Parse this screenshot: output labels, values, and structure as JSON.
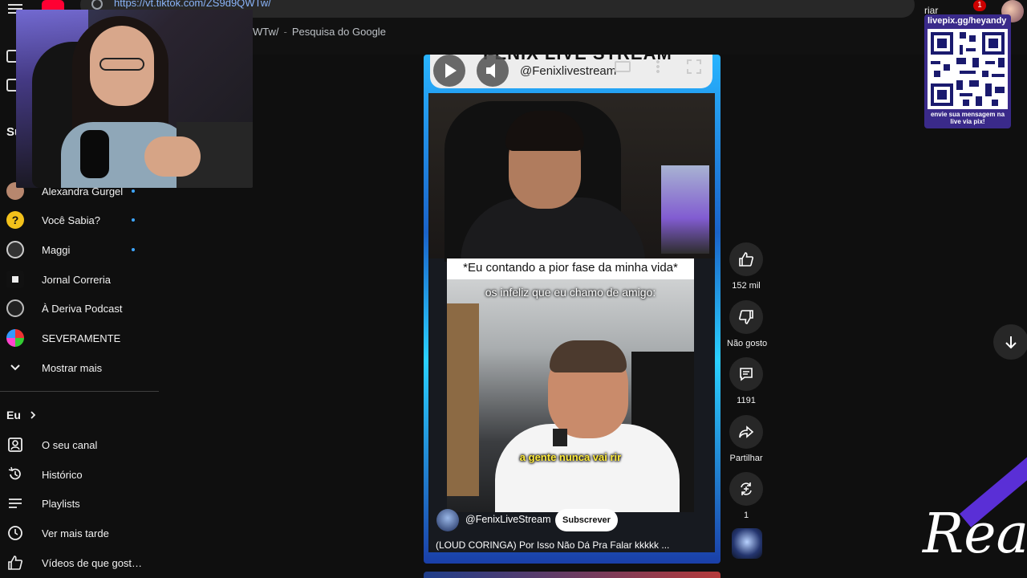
{
  "browser": {
    "url": "https://vt.tiktok.com/ZS9d9QWTw/",
    "suggestion_fragment": "WTw/",
    "suggestion_sep": "-",
    "suggestion_engine": "Pesquisa do Google"
  },
  "header": {
    "create_label": "riar",
    "notifications_count": "1"
  },
  "sidebar": {
    "subscriptions_partial": "Su",
    "subscriptions": [
      {
        "label": "Alexandra Gurgel",
        "icon": "channel-avatar",
        "new": true
      },
      {
        "label": "Você Sabia?",
        "icon": "question-icon",
        "new": true
      },
      {
        "label": "Maggi",
        "icon": "channel-avatar",
        "new": true
      },
      {
        "label": "Jornal Correria",
        "icon": "channel-avatar",
        "new": false
      },
      {
        "label": "À Deriva Podcast",
        "icon": "channel-avatar",
        "new": false
      },
      {
        "label": "SEVERAMENTE",
        "icon": "channel-avatar",
        "new": false
      },
      {
        "label": "Mostrar mais",
        "icon": "chevron-down-icon",
        "new": false
      }
    ],
    "you_heading": "Eu",
    "you_items": [
      {
        "label": "O seu canal",
        "icon": "person-box-icon"
      },
      {
        "label": "Histórico",
        "icon": "history-icon"
      },
      {
        "label": "Playlists",
        "icon": "playlist-icon"
      },
      {
        "label": "Ver mais tarde",
        "icon": "clock-icon"
      },
      {
        "label": "Vídeos de que gost…",
        "icon": "thumb-up-icon"
      }
    ]
  },
  "short": {
    "banner_text": "FENIX LIVE STREAM",
    "handle_overlay": "@Fenixlivestream",
    "caption": "*Eu contando a pior fase da minha vida*",
    "meme_text": "os infeliz que eu chamo de amigo:",
    "subtitle": "a gente nunca vai rir",
    "channel": "@FenixLiveStream",
    "subscribe_label": "Subscrever",
    "title": "(LOUD CORINGA) Por Isso Não Dá Pra Falar kkkkk ..."
  },
  "actions": {
    "like_count": "152 mil",
    "dislike_label": "Não gosto",
    "comments_count": "1191",
    "share_label": "Partilhar",
    "remix_count": "1"
  },
  "overlay": {
    "qr_title": "livepix.gg/heyandy",
    "qr_caption": "envie sua mensagem na live via pix!",
    "brand_mark": "React"
  },
  "colors": {
    "accent_blue": "#3ea6ff",
    "frame_blue": "#28b4ff",
    "subtitle_yellow": "#ffeb3b",
    "overlay_purple": "#5a2fd6"
  }
}
